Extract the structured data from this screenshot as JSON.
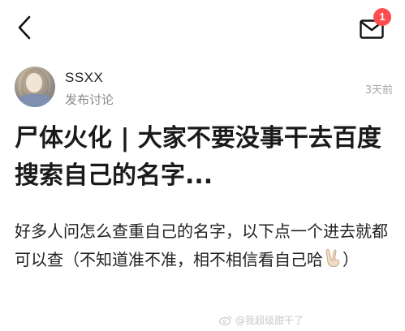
{
  "header": {
    "back_icon": "chevron-left-icon",
    "mail_icon": "envelope-icon",
    "notification_count": "1",
    "badge_color": "#ff4d4f"
  },
  "author": {
    "name": "SSXX",
    "subtitle": "发布讨论",
    "time": "3天前"
  },
  "post": {
    "title": "尸体火化 | 大家不要没事干去百度搜索自己的名字...",
    "body_before_emoji": "好多人问怎么查重自己的名字，以下点一个进去就都可以查（不知道准不准，相不相信看自己哈",
    "emoji": "victory-hand-emoji",
    "body_after_emoji": "）"
  },
  "watermark": {
    "icon": "weibo-icon",
    "text": "@我超级甜干了"
  }
}
